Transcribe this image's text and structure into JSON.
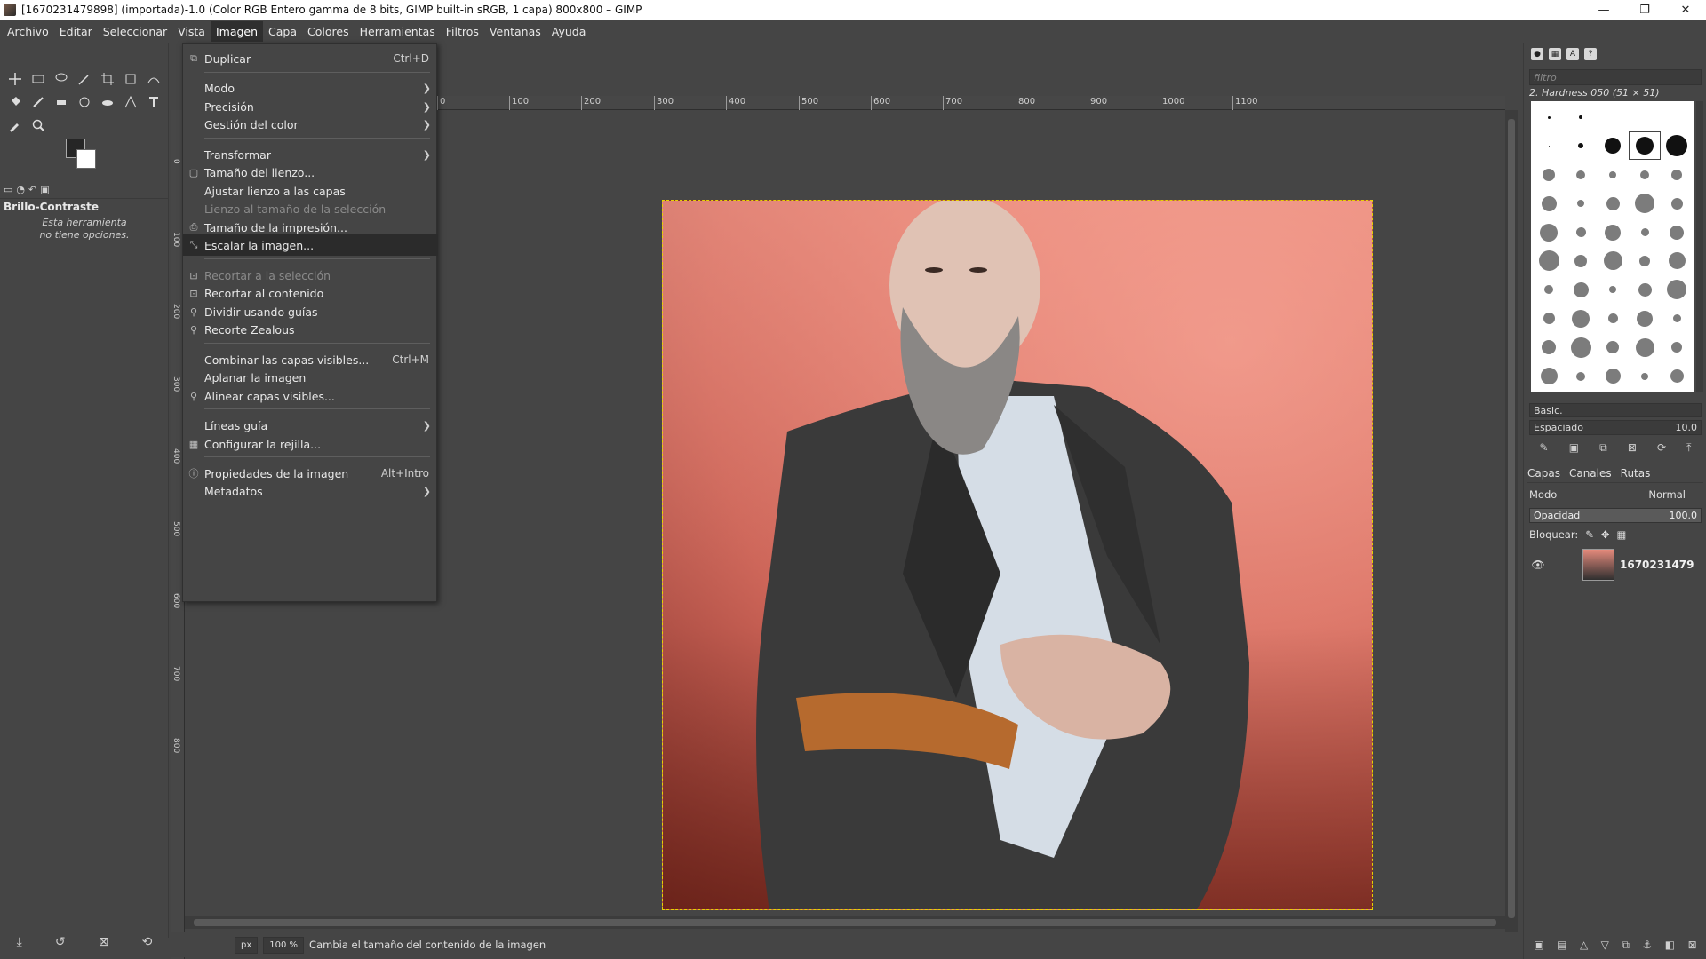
{
  "window": {
    "title": "[1670231479898] (importada)-1.0 (Color RGB Entero gamma de 8 bits, GIMP built-in sRGB, 1 capa) 800x800 – GIMP",
    "controls": [
      "—",
      "❐",
      "✕"
    ]
  },
  "menubar": {
    "items": [
      "Archivo",
      "Editar",
      "Seleccionar",
      "Vista",
      "Imagen",
      "Capa",
      "Colores",
      "Herramientas",
      "Filtros",
      "Ventanas",
      "Ayuda"
    ],
    "active": "Imagen"
  },
  "image_menu": {
    "items": [
      {
        "label": "Duplicar",
        "shortcut": "Ctrl+D",
        "icon": "duplicate-icon"
      },
      {
        "label": "Modo",
        "submenu": true
      },
      {
        "label": "Precisión",
        "submenu": true
      },
      {
        "label": "Gestión del color",
        "submenu": true
      },
      {
        "label": "Transformar",
        "submenu": true
      },
      {
        "label": "Tamaño del lienzo...",
        "icon": "canvas-size-icon"
      },
      {
        "label": "Ajustar lienzo a las capas"
      },
      {
        "label": "Lienzo al tamaño de la selección",
        "disabled": true
      },
      {
        "label": "Tamaño de la impresión...",
        "icon": "print-size-icon"
      },
      {
        "label": "Escalar la imagen...",
        "icon": "scale-icon",
        "highlighted": true
      },
      {
        "label": "Recortar a la selección",
        "disabled": true,
        "icon": "crop-icon"
      },
      {
        "label": "Recortar al contenido",
        "icon": "crop-icon"
      },
      {
        "label": "Dividir usando guías",
        "icon": "guillotine-icon"
      },
      {
        "label": "Recorte Zealous",
        "icon": "zealous-crop-icon"
      },
      {
        "label": "Combinar las capas visibles...",
        "shortcut": "Ctrl+M"
      },
      {
        "label": "Aplanar la imagen"
      },
      {
        "label": "Alinear capas visibles...",
        "icon": "align-icon"
      },
      {
        "label": "Líneas guía",
        "submenu": true
      },
      {
        "label": "Configurar la rejilla...",
        "icon": "grid-icon"
      },
      {
        "label": "Propiedades de la imagen",
        "shortcut": "Alt+Intro",
        "icon": "info-icon"
      },
      {
        "label": "Metadatos",
        "submenu": true
      }
    ]
  },
  "toolbox": {
    "tool_name": "Brillo-Contraste",
    "tool_desc_line1": "Esta herramienta",
    "tool_desc_line2": "no tiene opciones."
  },
  "rulers": {
    "h_labels": [
      "0",
      "100",
      "200",
      "300",
      "400",
      "500",
      "600",
      "700",
      "800",
      "900",
      "1000",
      "1100"
    ],
    "v_labels": [
      "0",
      "100",
      "200",
      "300",
      "400",
      "500",
      "600",
      "700",
      "800"
    ]
  },
  "statusbar": {
    "unit": "px",
    "zoom": "100 %",
    "message": "Cambia el tamaño del contenido de la imagen"
  },
  "brushes": {
    "filter_placeholder": "filtro",
    "selected_name": "2. Hardness 050 (51 × 51)",
    "set": "Basic.",
    "spacing_label": "Espaciado",
    "spacing_value": "10.0"
  },
  "layers": {
    "tabs": [
      "Capas",
      "Canales",
      "Rutas"
    ],
    "mode_label": "Modo",
    "mode_value": "Normal",
    "opacity_label": "Opacidad",
    "opacity_value": "100.0",
    "lock_label": "Bloquear:",
    "layer_name": "1670231479"
  },
  "colors": {
    "fg": "#262626",
    "bg": "#ffffff",
    "selection_border": "#e6d200",
    "menu_highlight": "#2b2b2b"
  }
}
